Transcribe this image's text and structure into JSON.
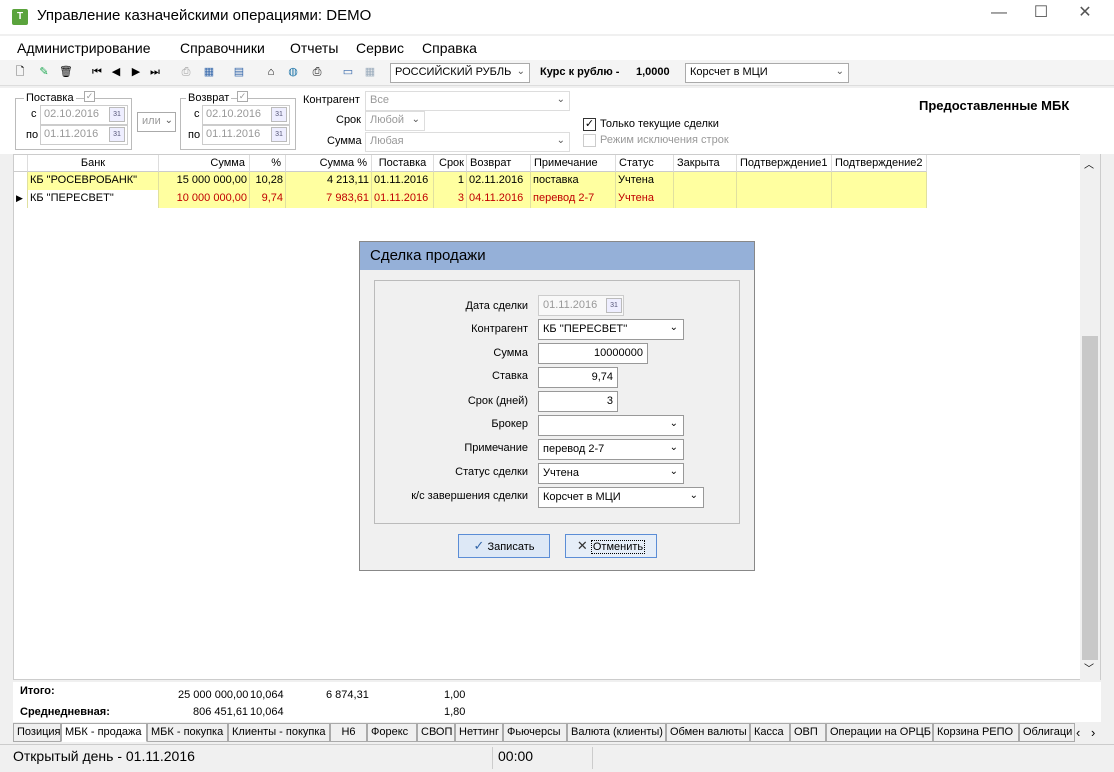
{
  "window": {
    "title": "Управление казначейскими операциями: DEMO",
    "icon_letter": "T"
  },
  "menu": [
    "Администрирование",
    "Справочники",
    "Отчеты",
    "Сервис",
    "Справка"
  ],
  "toolbar": {
    "currency": "РОССИЙСКИЙ РУБЛЬ",
    "rate_label": "Курс к рублю -",
    "rate_value": "1,0000",
    "account": "Корсчет в МЦИ"
  },
  "filter": {
    "delivery_label": "Поставка",
    "return_label": "Возврат",
    "from": "с",
    "to": "по",
    "delivery_from": "02.10.2016",
    "delivery_to": "01.11.2016",
    "return_from": "02.10.2016",
    "return_to": "01.11.2016",
    "or_value": "или",
    "counterparty_label": "Контрагент",
    "counterparty_value": "Все",
    "term_label": "Срок",
    "term_value": "Любой",
    "amount_label": "Сумма",
    "amount_value": "Любая",
    "only_current": "Только текущие сделки",
    "exclusion_mode": "Режим исключения строк",
    "section_title": "Предоставленные МБК"
  },
  "grid": {
    "headers": [
      "Банк",
      "Сумма",
      "%",
      "Сумма %",
      "Поставка",
      "Срок",
      "Возврат",
      "Примечание",
      "Статус",
      "Закрыта",
      "Подтверждение1",
      "Подтверждение2"
    ],
    "rows": [
      [
        "КБ \"РОСЕВРОБАНК\"",
        "15 000 000,00",
        "10,28",
        "4 213,11",
        "01.11.2016",
        "1",
        "02.11.2016",
        "поставка",
        "Учтена",
        "",
        "",
        ""
      ],
      [
        "КБ \"ПЕРЕСВЕТ\"",
        "10 000 000,00",
        "9,74",
        "7 983,61",
        "01.11.2016",
        "3",
        "04.11.2016",
        "перевод 2-7",
        "Учтена",
        "",
        "",
        ""
      ]
    ]
  },
  "totals": {
    "total_label": "Итого:",
    "avg_label": "Среднедневная:",
    "total_sum": "25 000 000,00",
    "total_pct": "10,064",
    "total_int": "6 874,31",
    "total_term": "1,00",
    "avg_sum": "806 451,61",
    "avg_pct": "10,064",
    "avg_term": "1,80"
  },
  "tabs": [
    "Позиция",
    "МБК - продажа",
    "МБК - покупка",
    "Клиенты - покупка",
    "Н6",
    "Форекс",
    "СВОП",
    "Неттинг",
    "Фьючерсы",
    "Валюта (клиенты)",
    "Обмен валюты",
    "Касса",
    "ОВП",
    "Операции на ОРЦБ",
    "Корзина РЕПО",
    "Облигаци"
  ],
  "status": {
    "day": "Открытый день - 01.11.2016",
    "time": "00:00"
  },
  "dialog": {
    "title": "Сделка продажи",
    "date_label": "Дата сделки",
    "date_value": "01.11.2016",
    "counterparty_label": "Контрагент",
    "counterparty_value": "КБ ''ПЕРЕСВЕТ''",
    "sum_label": "Сумма",
    "sum_value": "10000000",
    "rate_label": "Ставка",
    "rate_value": "9,74",
    "term_label": "Срок (дней)",
    "term_value": "3",
    "broker_label": "Брокер",
    "broker_value": "",
    "note_label": "Примечание",
    "note_value": "перевод 2-7",
    "status_label": "Статус сделки",
    "status_value": "Учтена",
    "account_label": "к/с завершения сделки",
    "account_value": "Корсчет в МЦИ",
    "save_label": "Записать",
    "cancel_label": "Отменить"
  },
  "colors": {
    "row_highlight": "#ffffa0",
    "dialog_title": "#95b0d8",
    "selected_text": "#c00000"
  }
}
